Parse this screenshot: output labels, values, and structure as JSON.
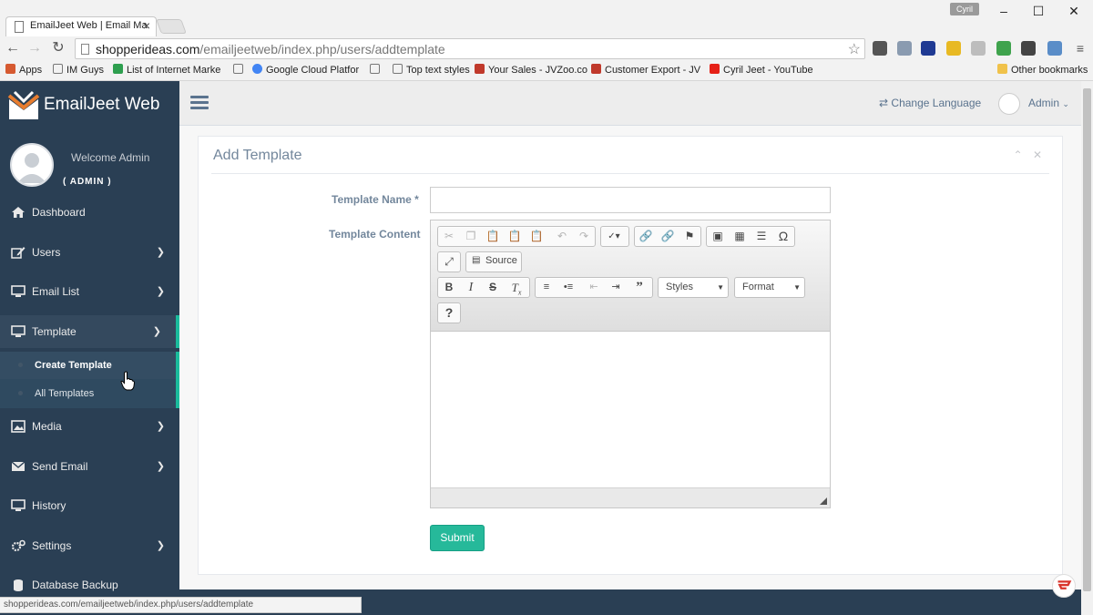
{
  "browser": {
    "tab_title": "EmailJeet Web | Email Ma",
    "tab_close": "×",
    "profile_name": "Cyril",
    "url_host": "shopperideas.com",
    "url_path": "/emailjeetweb/index.php/users/addtemplate",
    "status_url": "shopperideas.com/emailjeetweb/index.php/users/addtemplate",
    "bookmarks": [
      {
        "label": "Apps"
      },
      {
        "label": "IM Guys"
      },
      {
        "label": "List of Internet Marke"
      },
      {
        "label": "Google Cloud Platfor"
      },
      {
        "label": "Top text styles"
      },
      {
        "label": "Your Sales - JVZoo.co"
      },
      {
        "label": "Customer Export - JV"
      },
      {
        "label": "Cyril Jeet - YouTube"
      },
      {
        "label": "Other bookmarks"
      }
    ]
  },
  "sidebar": {
    "brand": "EmailJeet Web",
    "welcome": "Welcome Admin",
    "role": "( ADMIN )",
    "items": [
      {
        "label": "Dashboard",
        "icon": "home-icon"
      },
      {
        "label": "Users",
        "icon": "edit-icon"
      },
      {
        "label": "Email List",
        "icon": "desktop-icon"
      },
      {
        "label": "Template",
        "icon": "desktop-icon"
      },
      {
        "label": "Media",
        "icon": "image-icon"
      },
      {
        "label": "Send Email",
        "icon": "envelope-icon"
      },
      {
        "label": "History",
        "icon": "desktop-icon"
      },
      {
        "label": "Settings",
        "icon": "cogs-icon"
      },
      {
        "label": "Database Backup",
        "icon": "database-icon"
      }
    ],
    "template_submenu": [
      {
        "label": "Create Template"
      },
      {
        "label": "All Templates"
      }
    ]
  },
  "topnav": {
    "change_language": "Change Language",
    "admin": "Admin"
  },
  "panel": {
    "title": "Add Template",
    "template_name_label": "Template Name *",
    "template_name_value": "",
    "template_content_label": "Template Content",
    "source_label": "Source",
    "styles_label": "Styles",
    "format_label": "Format",
    "submit_label": "Submit"
  },
  "colors": {
    "sidebar_bg": "#2a3f54",
    "accent_green": "#1abb9c",
    "submit_bg": "#26b99a",
    "muted_text": "#73879c"
  }
}
